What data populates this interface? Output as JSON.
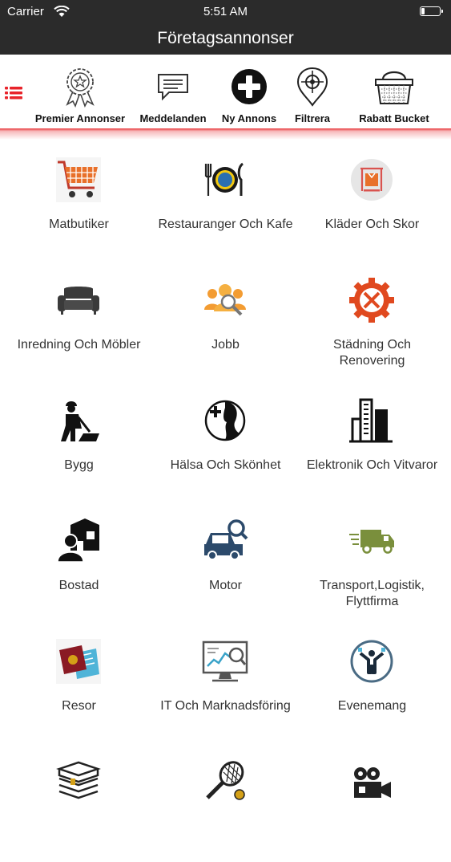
{
  "status_bar": {
    "carrier": "Carrier",
    "time": "5:51 AM"
  },
  "nav": {
    "title": "Företagsannonser"
  },
  "toolbar": {
    "items": [
      {
        "label": "Premier Annonser",
        "icon": "award-badge-icon"
      },
      {
        "label": "Meddelanden",
        "icon": "chat-bubble-icon"
      },
      {
        "label": "Ny Annons",
        "icon": "plus-circle-icon"
      },
      {
        "label": "Filtrera",
        "icon": "filter-target-icon"
      },
      {
        "label": "Rabatt Bucket",
        "icon": "basket-icon"
      }
    ]
  },
  "categories": [
    {
      "label": "Matbutiker",
      "icon": "shopping-cart-icon"
    },
    {
      "label": "Restauranger Och Kafe",
      "icon": "plate-cutlery-icon"
    },
    {
      "label": "Kläder Och Skor",
      "icon": "clothes-rack-icon"
    },
    {
      "label": "Inredning Och Möbler",
      "icon": "sofa-icon"
    },
    {
      "label": "Jobb",
      "icon": "people-search-icon"
    },
    {
      "label": "Städning Och Renovering",
      "icon": "gear-tools-icon"
    },
    {
      "label": "Bygg",
      "icon": "construction-worker-icon"
    },
    {
      "label": "Hälsa Och Skönhet",
      "icon": "face-health-icon"
    },
    {
      "label": "Elektronik Och Vitvaror",
      "icon": "buildings-icon"
    },
    {
      "label": "Bostad",
      "icon": "house-agent-icon"
    },
    {
      "label": "Motor",
      "icon": "car-search-icon"
    },
    {
      "label": "Transport,Logistik, Flyttfirma",
      "icon": "delivery-truck-icon"
    },
    {
      "label": "Resor",
      "icon": "passport-icon"
    },
    {
      "label": "IT Och Marknadsföring",
      "icon": "analytics-screen-icon"
    },
    {
      "label": "Evenemang",
      "icon": "event-person-icon"
    },
    {
      "label": "",
      "icon": "books-icon"
    },
    {
      "label": "",
      "icon": "tennis-racket-icon"
    },
    {
      "label": "",
      "icon": "film-camera-icon"
    }
  ]
}
